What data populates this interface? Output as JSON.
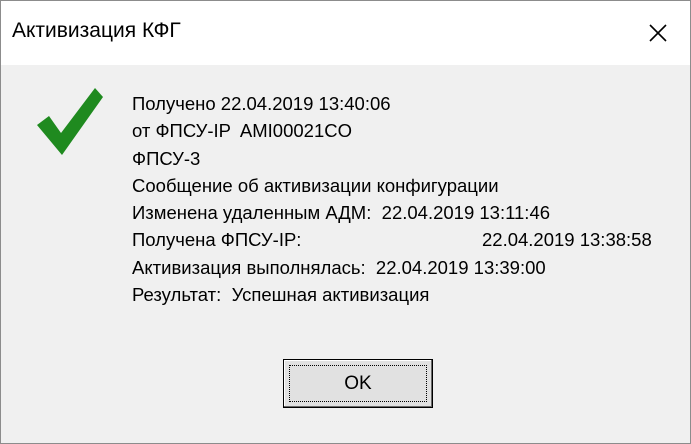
{
  "window": {
    "title": "Активизация КФГ"
  },
  "icons": {
    "status": "checkmark-icon",
    "close": "close-icon"
  },
  "colors": {
    "check": "#1f8a1f",
    "background": "#f0f0f0",
    "titlebar": "#ffffff"
  },
  "message": {
    "received_line": "Получено 22.04.2019 13:40:06",
    "from_line": "от ФПСУ-IP  AMI00021CO",
    "device_line": "ФПСУ-3",
    "subject_line": "Сообщение об активизации конфигурации",
    "changed_label": "Изменена удаленным АДМ:",
    "changed_value": "22.04.2019 13:11:46",
    "received_fpsu_label": "Получена ФПСУ-IP:",
    "received_fpsu_value": "22.04.2019 13:38:58",
    "performed_label": "Активизация выполнялась:",
    "performed_value": "22.04.2019 13:39:00",
    "result_label": "Результат:",
    "result_value": "Успешная активизация"
  },
  "buttons": {
    "ok_label": "OK"
  }
}
